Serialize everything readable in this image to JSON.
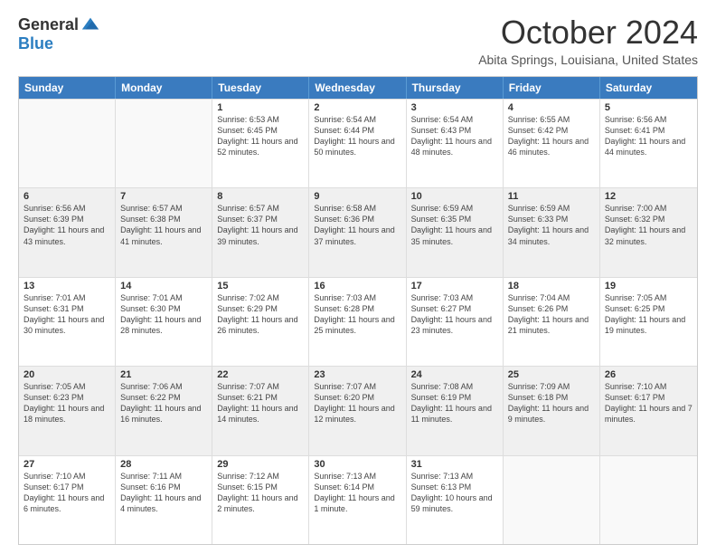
{
  "logo": {
    "general": "General",
    "blue": "Blue"
  },
  "title": "October 2024",
  "location": "Abita Springs, Louisiana, United States",
  "header_days": [
    "Sunday",
    "Monday",
    "Tuesday",
    "Wednesday",
    "Thursday",
    "Friday",
    "Saturday"
  ],
  "rows": [
    [
      {
        "day": "",
        "info": "",
        "empty": true
      },
      {
        "day": "",
        "info": "",
        "empty": true
      },
      {
        "day": "1",
        "info": "Sunrise: 6:53 AM\nSunset: 6:45 PM\nDaylight: 11 hours and 52 minutes."
      },
      {
        "day": "2",
        "info": "Sunrise: 6:54 AM\nSunset: 6:44 PM\nDaylight: 11 hours and 50 minutes."
      },
      {
        "day": "3",
        "info": "Sunrise: 6:54 AM\nSunset: 6:43 PM\nDaylight: 11 hours and 48 minutes."
      },
      {
        "day": "4",
        "info": "Sunrise: 6:55 AM\nSunset: 6:42 PM\nDaylight: 11 hours and 46 minutes."
      },
      {
        "day": "5",
        "info": "Sunrise: 6:56 AM\nSunset: 6:41 PM\nDaylight: 11 hours and 44 minutes."
      }
    ],
    [
      {
        "day": "6",
        "info": "Sunrise: 6:56 AM\nSunset: 6:39 PM\nDaylight: 11 hours and 43 minutes."
      },
      {
        "day": "7",
        "info": "Sunrise: 6:57 AM\nSunset: 6:38 PM\nDaylight: 11 hours and 41 minutes."
      },
      {
        "day": "8",
        "info": "Sunrise: 6:57 AM\nSunset: 6:37 PM\nDaylight: 11 hours and 39 minutes."
      },
      {
        "day": "9",
        "info": "Sunrise: 6:58 AM\nSunset: 6:36 PM\nDaylight: 11 hours and 37 minutes."
      },
      {
        "day": "10",
        "info": "Sunrise: 6:59 AM\nSunset: 6:35 PM\nDaylight: 11 hours and 35 minutes."
      },
      {
        "day": "11",
        "info": "Sunrise: 6:59 AM\nSunset: 6:33 PM\nDaylight: 11 hours and 34 minutes."
      },
      {
        "day": "12",
        "info": "Sunrise: 7:00 AM\nSunset: 6:32 PM\nDaylight: 11 hours and 32 minutes."
      }
    ],
    [
      {
        "day": "13",
        "info": "Sunrise: 7:01 AM\nSunset: 6:31 PM\nDaylight: 11 hours and 30 minutes."
      },
      {
        "day": "14",
        "info": "Sunrise: 7:01 AM\nSunset: 6:30 PM\nDaylight: 11 hours and 28 minutes."
      },
      {
        "day": "15",
        "info": "Sunrise: 7:02 AM\nSunset: 6:29 PM\nDaylight: 11 hours and 26 minutes."
      },
      {
        "day": "16",
        "info": "Sunrise: 7:03 AM\nSunset: 6:28 PM\nDaylight: 11 hours and 25 minutes."
      },
      {
        "day": "17",
        "info": "Sunrise: 7:03 AM\nSunset: 6:27 PM\nDaylight: 11 hours and 23 minutes."
      },
      {
        "day": "18",
        "info": "Sunrise: 7:04 AM\nSunset: 6:26 PM\nDaylight: 11 hours and 21 minutes."
      },
      {
        "day": "19",
        "info": "Sunrise: 7:05 AM\nSunset: 6:25 PM\nDaylight: 11 hours and 19 minutes."
      }
    ],
    [
      {
        "day": "20",
        "info": "Sunrise: 7:05 AM\nSunset: 6:23 PM\nDaylight: 11 hours and 18 minutes."
      },
      {
        "day": "21",
        "info": "Sunrise: 7:06 AM\nSunset: 6:22 PM\nDaylight: 11 hours and 16 minutes."
      },
      {
        "day": "22",
        "info": "Sunrise: 7:07 AM\nSunset: 6:21 PM\nDaylight: 11 hours and 14 minutes."
      },
      {
        "day": "23",
        "info": "Sunrise: 7:07 AM\nSunset: 6:20 PM\nDaylight: 11 hours and 12 minutes."
      },
      {
        "day": "24",
        "info": "Sunrise: 7:08 AM\nSunset: 6:19 PM\nDaylight: 11 hours and 11 minutes."
      },
      {
        "day": "25",
        "info": "Sunrise: 7:09 AM\nSunset: 6:18 PM\nDaylight: 11 hours and 9 minutes."
      },
      {
        "day": "26",
        "info": "Sunrise: 7:10 AM\nSunset: 6:17 PM\nDaylight: 11 hours and 7 minutes."
      }
    ],
    [
      {
        "day": "27",
        "info": "Sunrise: 7:10 AM\nSunset: 6:17 PM\nDaylight: 11 hours and 6 minutes."
      },
      {
        "day": "28",
        "info": "Sunrise: 7:11 AM\nSunset: 6:16 PM\nDaylight: 11 hours and 4 minutes."
      },
      {
        "day": "29",
        "info": "Sunrise: 7:12 AM\nSunset: 6:15 PM\nDaylight: 11 hours and 2 minutes."
      },
      {
        "day": "30",
        "info": "Sunrise: 7:13 AM\nSunset: 6:14 PM\nDaylight: 11 hours and 1 minute."
      },
      {
        "day": "31",
        "info": "Sunrise: 7:13 AM\nSunset: 6:13 PM\nDaylight: 10 hours and 59 minutes."
      },
      {
        "day": "",
        "info": "",
        "empty": true
      },
      {
        "day": "",
        "info": "",
        "empty": true
      }
    ]
  ]
}
